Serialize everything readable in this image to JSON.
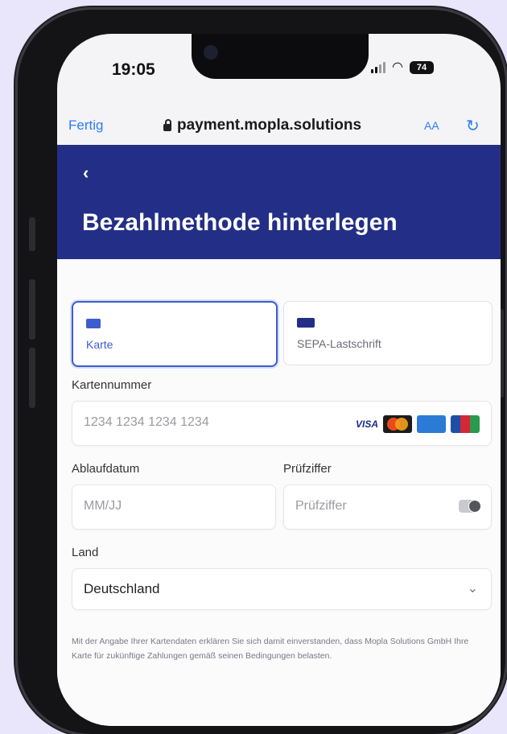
{
  "status_bar": {
    "time": "19:05",
    "battery": "74"
  },
  "browser": {
    "done_label": "Fertig",
    "url": "payment.mopla.solutions",
    "text_size_label": "AA",
    "reload_icon": "reload-icon"
  },
  "header": {
    "back_icon": "chevron-left-icon",
    "title": "Bezahlmethode hinterlegen",
    "bg_color": "#232f86"
  },
  "payment_methods": [
    {
      "label": "Karte",
      "icon": "card-icon",
      "selected": true,
      "color": "#3d5ccd"
    },
    {
      "label": "SEPA-Lastschrift",
      "icon": "bank-icon",
      "selected": false,
      "color": "#232f86"
    }
  ],
  "card_number": {
    "label": "Kartennummer",
    "placeholder": "1234 1234 1234 1234",
    "brand_text": "VISA"
  },
  "expiry": {
    "label": "Ablaufdatum",
    "placeholder": "MM/JJ"
  },
  "cvc": {
    "label": "Prüfziffer",
    "placeholder": "Prüfziffer"
  },
  "country": {
    "label": "Land",
    "value": "Deutschland"
  },
  "legal": "Mit der Angabe Ihrer Kartendaten erklären Sie sich damit einverstanden, dass Mopla Solutions GmbH Ihre Karte für zukünftige Zahlungen gemäß seinen Bedingungen belasten."
}
